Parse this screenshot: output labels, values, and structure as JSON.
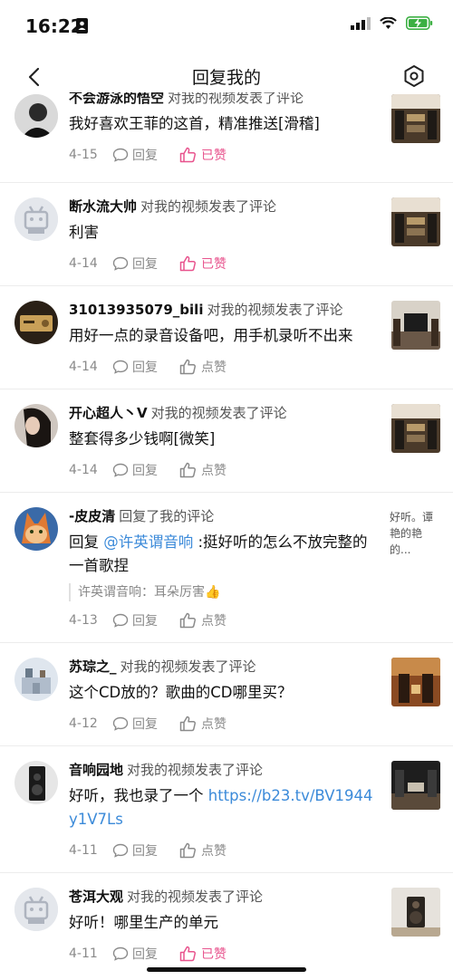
{
  "status": {
    "time": "16:22"
  },
  "nav": {
    "title": "回复我的"
  },
  "items": [
    {
      "user": "不会游泳的悟空",
      "action": "对我的视频发表了评论",
      "text": "我好喜欢王菲的这首，精准推送[滑稽]",
      "date": "4-15",
      "reply": "回复",
      "like": "已赞",
      "liked": true
    },
    {
      "user": "断水流大帅",
      "action": "对我的视频发表了评论",
      "text": "利害",
      "date": "4-14",
      "reply": "回复",
      "like": "已赞",
      "liked": true
    },
    {
      "user": "31013935079_bili",
      "action": "对我的视频发表了评论",
      "text": "用好一点的录音设备吧，用手机录听不出来",
      "date": "4-14",
      "reply": "回复",
      "like": "点赞",
      "liked": false
    },
    {
      "user": "开心超人丶V",
      "action": "对我的视频发表了评论",
      "text": "整套得多少钱啊[微笑]",
      "date": "4-14",
      "reply": "回复",
      "like": "点赞",
      "liked": false
    },
    {
      "user": "-皮皮清",
      "action": "回复了我的评论",
      "text_prefix": "回复 ",
      "mention": "@许英谓音响",
      "text": " :挺好听的怎么不放完整的一首歌捏",
      "quote": "许英谓音响：耳朵厉害👍",
      "thumb_text": "好听。谭艳的艳的...",
      "date": "4-13",
      "reply": "回复",
      "like": "点赞",
      "liked": false
    },
    {
      "user": "苏琮之_",
      "action": "对我的视频发表了评论",
      "text": "这个CD放的？歌曲的CD哪里买？",
      "date": "4-12",
      "reply": "回复",
      "like": "点赞",
      "liked": false
    },
    {
      "user": "音响园地",
      "action": "对我的视频发表了评论",
      "text": "好听，我也录了一个 ",
      "link": "https://b23.tv/BV1944y1V7Ls",
      "date": "4-11",
      "reply": "回复",
      "like": "点赞",
      "liked": false
    },
    {
      "user": "苍洱大观",
      "action": "对我的视频发表了评论",
      "text": "好听！哪里生产的单元",
      "date": "4-11",
      "reply": "回复",
      "like": "已赞",
      "liked": true
    }
  ]
}
